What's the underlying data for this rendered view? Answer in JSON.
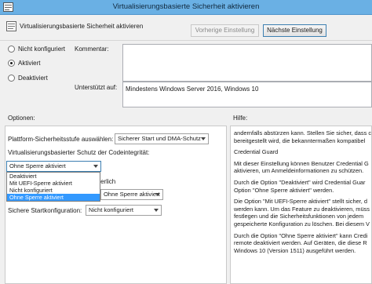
{
  "window": {
    "title": "Virtualisierungsbasierte Sicherheit aktivieren"
  },
  "header": {
    "policy_title": "Virtualisierungsbasierte Sicherheit aktivieren",
    "prev_label": "Vorherige Einstellung",
    "next_label": "Nächste Einstellung"
  },
  "state": {
    "options": [
      {
        "label": "Nicht konfiguriert",
        "checked": false
      },
      {
        "label": "Aktiviert",
        "checked": true
      },
      {
        "label": "Deaktiviert",
        "checked": false
      }
    ]
  },
  "comment": {
    "label": "Kommentar:",
    "value": ""
  },
  "supported": {
    "label": "Unterstützt auf:",
    "value": "Mindestens Windows Server 2016, Windows 10"
  },
  "sections": {
    "options_label": "Optionen:",
    "help_label": "Hilfe:"
  },
  "options_pane": {
    "platform_label": "Plattform-Sicherheitsstufe auswählen:",
    "platform_value": "Sicherer Start und DMA-Schutz",
    "integrity_label": "Virtualisierungsbasierter Schutz der Codeintegrität:",
    "integrity_value": "Ohne Sperre aktiviert",
    "integrity_options": [
      "Deaktiviert",
      "Mit UEFI-Sperre aktiviert",
      "Nicht konfiguriert",
      "Ohne Sperre aktiviert"
    ],
    "hidden_label_fragment": "rderlich",
    "credential_value": "Ohne Sperre aktiviert",
    "startup_label": "Sichere Startkonfiguration:",
    "startup_value": "Nicht konfiguriert"
  },
  "help_pane": {
    "paragraphs": [
      [
        "andernfalls abstürzen kann. Stellen Sie sicher, dass c",
        "bereitgestellt wird, die bekanntermaßen kompatibel"
      ],
      [
        "Credential Guard"
      ],
      [
        "Mit dieser Einstellung können Benutzer Credential G",
        "aktivieren, um Anmeldeinformationen zu schützen."
      ],
      [
        "Durch die Option \"Deaktiviert\" wird Credential Guar",
        "Option \"Ohne Sperre aktiviert\" werden."
      ],
      [
        "Die Option \"Mit UEFI-Sperre aktiviert\" stellt sicher, d",
        "werden kann. Um das Feature zu deaktivieren, müss",
        "festlegen und die Sicherheitsfunktionen von jedem",
        "gespeicherte Konfiguration zu löschen. Bei diesem V"
      ],
      [
        "Durch die Option \"Ohne Sperre aktiviert\" kann Credi",
        "remote deaktiviert werden. Auf Geräten, die diese R",
        "Windows 10 (Version 1511) ausgeführt werden."
      ]
    ]
  },
  "colors": {
    "titlebar": "#6ab0e4",
    "selection": "#3399ff"
  }
}
